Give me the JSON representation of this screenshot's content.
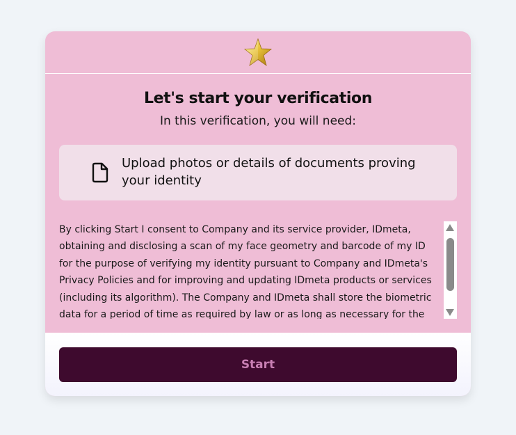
{
  "header": {
    "icon": "star-icon"
  },
  "main": {
    "title": "Let's start your verification",
    "subtitle": "In this verification, you will need:",
    "requirements": [
      {
        "icon": "document-icon",
        "text": "Upload photos or details of documents proving your identity"
      }
    ],
    "consent_text": "By clicking Start I consent to Company and its service provider, IDmeta, obtaining and disclosing a scan of my face geometry and barcode of my ID for the purpose of verifying my identity pursuant to Company and IDmeta's Privacy Policies and for improving and updating IDmeta products or services (including its algorithm). The Company and IDmeta shall store the biometric data for a period of time as required by law or as long as necessary for the"
  },
  "footer": {
    "start_label": "Start"
  },
  "colors": {
    "page_background": "#f0f4f8",
    "card_background": "#efbdd6",
    "requirement_box": "#f1dfe9",
    "button_background": "#3e0a2e",
    "button_text": "#c87fb3",
    "star_gold": "#e8c23a"
  }
}
